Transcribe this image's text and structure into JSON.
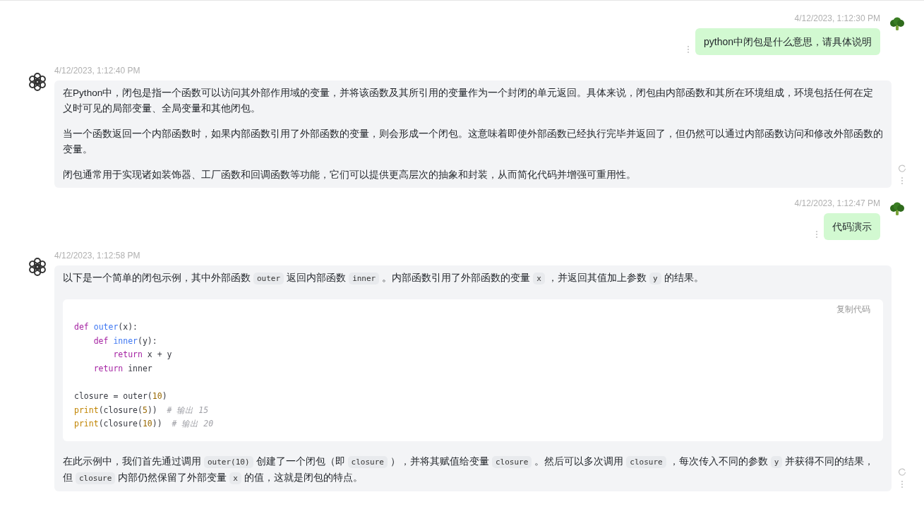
{
  "messages": [
    {
      "kind": "user",
      "time": "4/12/2023, 1:12:30 PM",
      "text": "python中闭包是什么意思，请具体说明"
    },
    {
      "kind": "assistant",
      "time": "4/12/2023, 1:12:40 PM",
      "blocks": [
        {
          "kind": "paragraph",
          "segments": [
            {
              "kind": "text",
              "text": "在Python中，闭包是指一个函数可以访问其外部作用域的变量，并将该函数及其所引用的变量作为一个封闭的单元返回。具体来说，闭包由内部函数和其所在环境组成，环境包括任何在定义时可见的局部变量、全局变量和其他闭包。"
            }
          ]
        },
        {
          "kind": "paragraph",
          "segments": [
            {
              "kind": "text",
              "text": "当一个函数返回一个内部函数时，如果内部函数引用了外部函数的变量，则会形成一个闭包。这意味着即使外部函数已经执行完毕并返回了，但仍然可以通过内部函数访问和修改外部函数的变量。"
            }
          ]
        },
        {
          "kind": "paragraph",
          "segments": [
            {
              "kind": "text",
              "text": "闭包通常用于实现诸如装饰器、工厂函数和回调函数等功能，它们可以提供更高层次的抽象和封装，从而简化代码并增强可重用性。"
            }
          ]
        }
      ]
    },
    {
      "kind": "user",
      "time": "4/12/2023, 1:12:47 PM",
      "text": "代码演示"
    },
    {
      "kind": "assistant",
      "time": "4/12/2023, 1:12:58 PM",
      "blocks": [
        {
          "kind": "paragraph",
          "segments": [
            {
              "kind": "text",
              "text": "以下是一个简单的闭包示例，其中外部函数"
            },
            {
              "kind": "code",
              "text": "outer"
            },
            {
              "kind": "text",
              "text": "返回内部函数"
            },
            {
              "kind": "code",
              "text": "inner"
            },
            {
              "kind": "text",
              "text": "。内部函数引用了外部函数的变量"
            },
            {
              "kind": "code",
              "text": "x"
            },
            {
              "kind": "text",
              "text": "，并返回其值加上参数"
            },
            {
              "kind": "code",
              "text": "y"
            },
            {
              "kind": "text",
              "text": "的结果。"
            }
          ]
        },
        {
          "kind": "codeblock",
          "copy_label": "复制代码",
          "lines": [
            {
              "kind": "code",
              "tokens": [
                {
                  "kind": "keyword",
                  "text": "def "
                },
                {
                  "kind": "function",
                  "text": "outer"
                },
                {
                  "kind": "plain",
                  "text": "(x):"
                }
              ]
            },
            {
              "kind": "code",
              "tokens": [
                {
                  "kind": "keyword",
                  "text": "    def "
                },
                {
                  "kind": "function",
                  "text": "inner"
                },
                {
                  "kind": "plain",
                  "text": "(y):"
                }
              ]
            },
            {
              "kind": "code",
              "tokens": [
                {
                  "kind": "keyword",
                  "text": "        return "
                },
                {
                  "kind": "plain",
                  "text": "x + y"
                }
              ]
            },
            {
              "kind": "code",
              "tokens": [
                {
                  "kind": "keyword",
                  "text": "    return "
                },
                {
                  "kind": "plain",
                  "text": "inner"
                }
              ]
            },
            {
              "kind": "blank"
            },
            {
              "kind": "code",
              "tokens": [
                {
                  "kind": "plain",
                  "text": "closure = outer("
                },
                {
                  "kind": "number",
                  "text": "10"
                },
                {
                  "kind": "plain",
                  "text": ")"
                }
              ]
            },
            {
              "kind": "code",
              "tokens": [
                {
                  "kind": "builtin",
                  "text": "print"
                },
                {
                  "kind": "plain",
                  "text": "(closure("
                },
                {
                  "kind": "number",
                  "text": "5"
                },
                {
                  "kind": "plain",
                  "text": "))  "
                },
                {
                  "kind": "comment",
                  "text": "# 输出 15"
                }
              ]
            },
            {
              "kind": "code",
              "tokens": [
                {
                  "kind": "builtin",
                  "text": "print"
                },
                {
                  "kind": "plain",
                  "text": "(closure("
                },
                {
                  "kind": "number",
                  "text": "10"
                },
                {
                  "kind": "plain",
                  "text": "))  "
                },
                {
                  "kind": "comment",
                  "text": "# 输出 20"
                }
              ]
            }
          ]
        },
        {
          "kind": "paragraph",
          "segments": [
            {
              "kind": "text",
              "text": "在此示例中，我们首先通过调用"
            },
            {
              "kind": "code",
              "text": "outer(10)"
            },
            {
              "kind": "text",
              "text": "创建了一个闭包（即"
            },
            {
              "kind": "code",
              "text": "closure"
            },
            {
              "kind": "text",
              "text": "），并将其赋值给变量"
            },
            {
              "kind": "code",
              "text": "closure"
            },
            {
              "kind": "text",
              "text": "。然后可以多次调用"
            },
            {
              "kind": "code",
              "text": "closure"
            },
            {
              "kind": "text",
              "text": "，每次传入不同的参数"
            },
            {
              "kind": "code",
              "text": "y"
            },
            {
              "kind": "text",
              "text": "并获得不同的结果，但"
            },
            {
              "kind": "code",
              "text": "closure"
            },
            {
              "kind": "text",
              "text": "内部仍然保留了外部变量"
            },
            {
              "kind": "code",
              "text": "x"
            },
            {
              "kind": "text",
              "text": "的值，这就是闭包的特点。"
            }
          ]
        }
      ]
    }
  ]
}
